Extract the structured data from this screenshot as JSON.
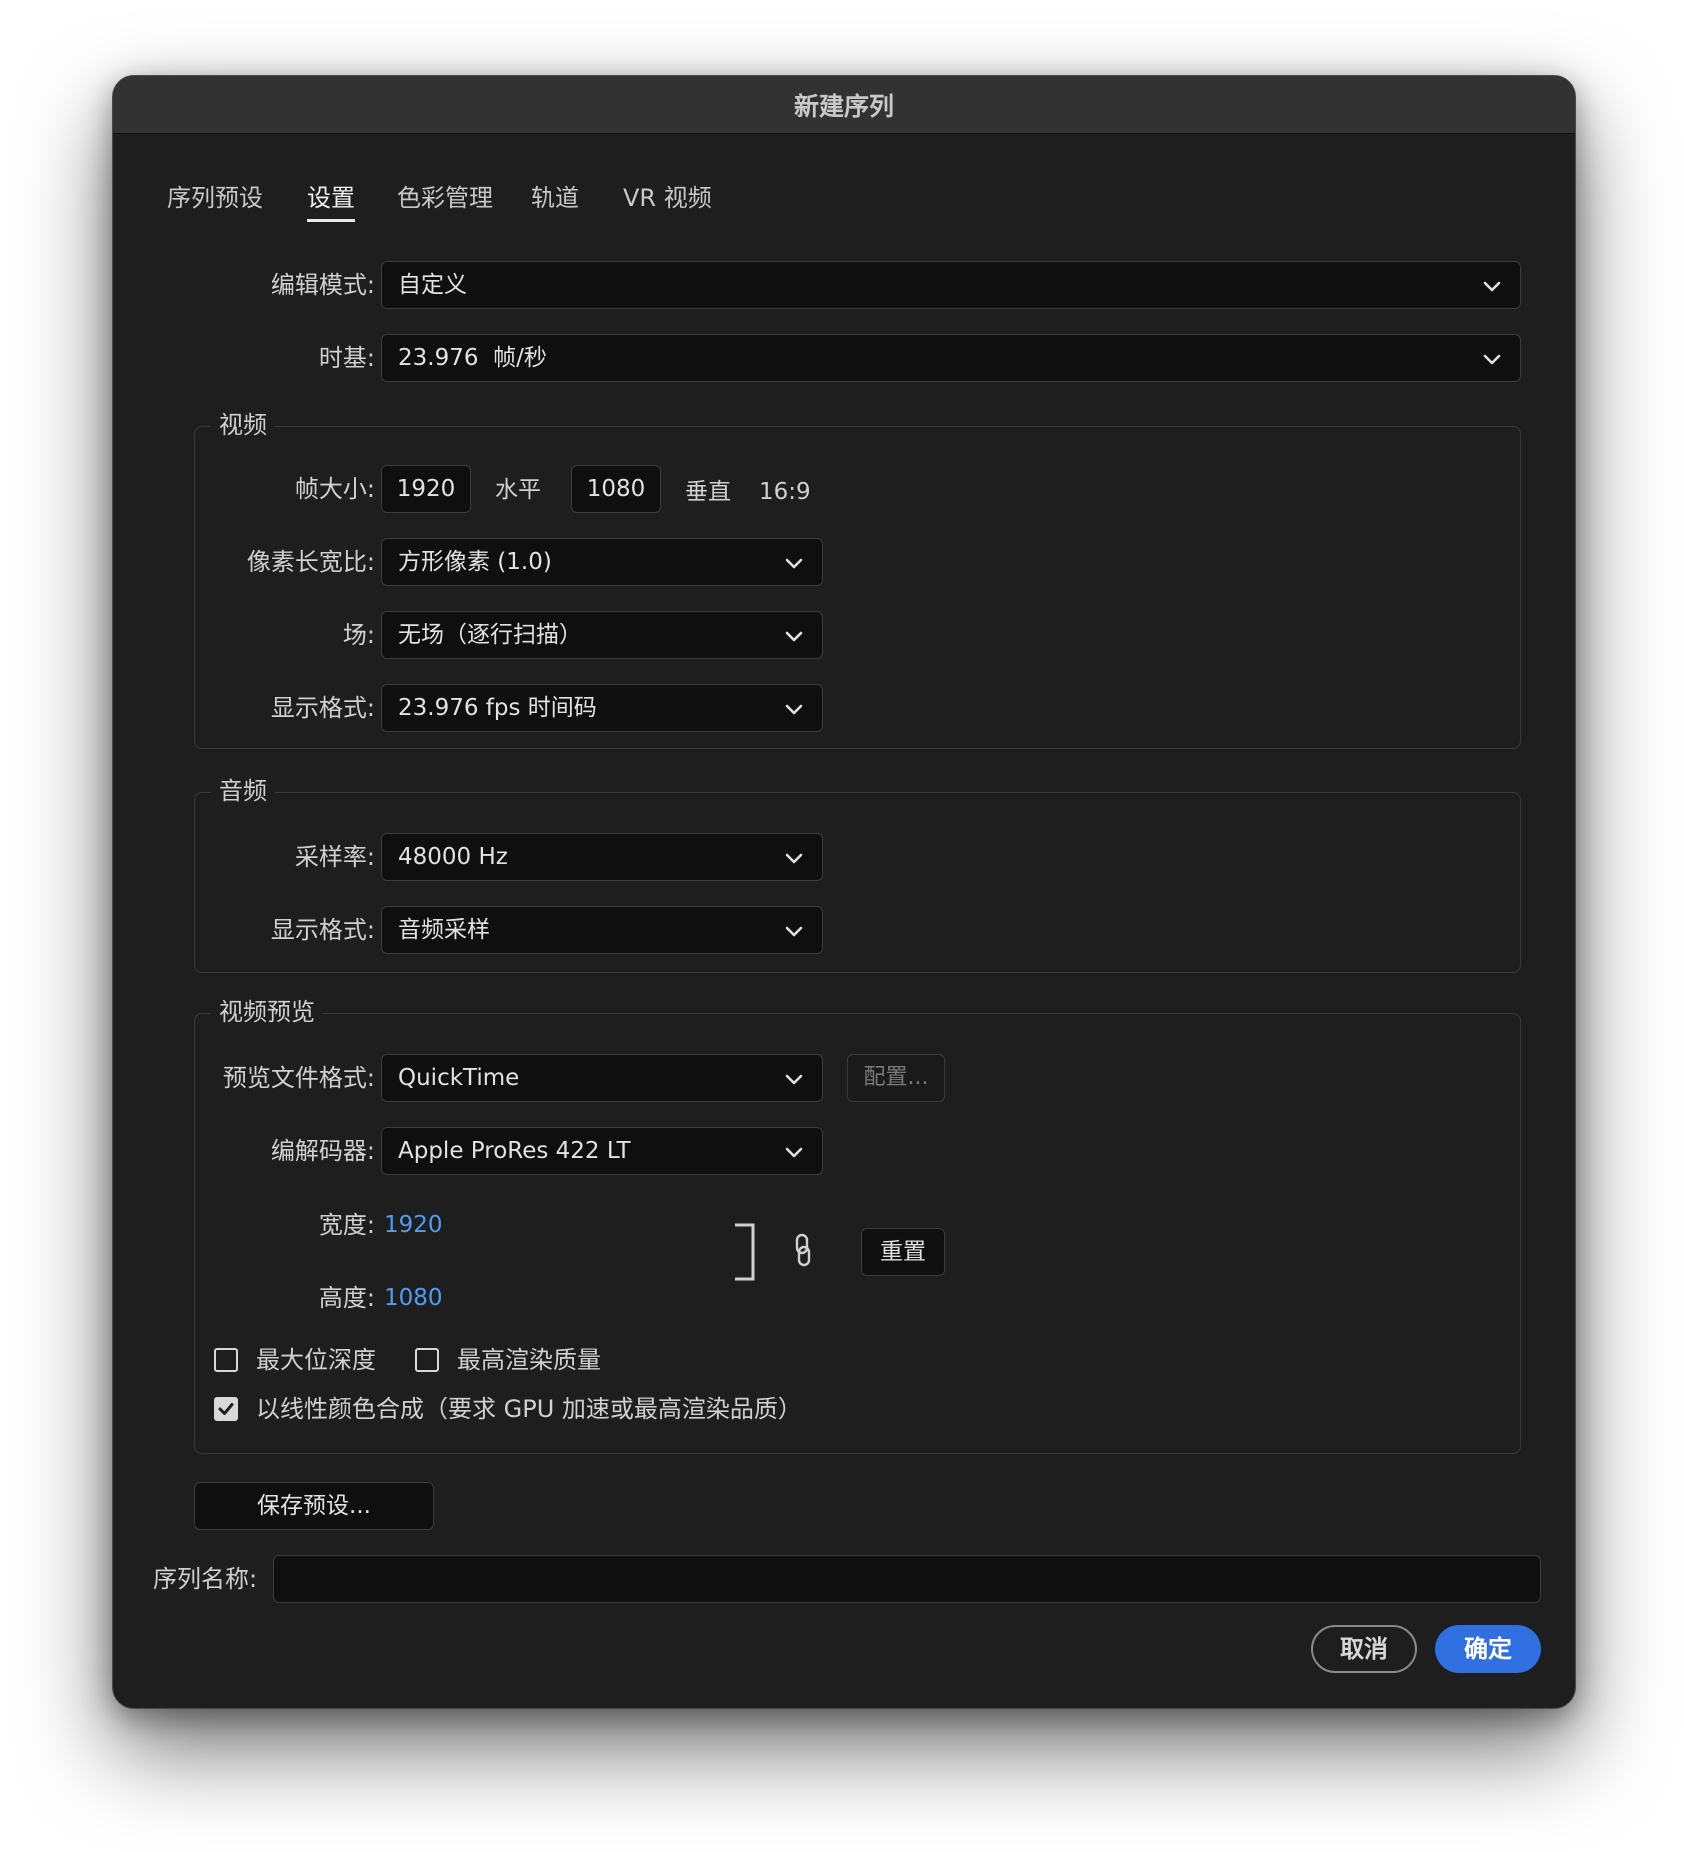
{
  "window": {
    "title": "新建序列"
  },
  "tabs": [
    {
      "label": "序列预设"
    },
    {
      "label": "设置"
    },
    {
      "label": "色彩管理"
    },
    {
      "label": "轨道"
    },
    {
      "label": "VR 视频"
    }
  ],
  "general": {
    "edit_mode_label": "编辑模式:",
    "edit_mode_value": "自定义",
    "timebase_label": "时基:",
    "timebase_value": "23.976  帧/秒"
  },
  "video": {
    "title": "视频",
    "frame_size_label": "帧大小:",
    "frame_width": "1920",
    "horizontal_label": "水平",
    "frame_height": "1080",
    "vertical_label": "垂直",
    "aspect": "16:9",
    "pixel_aspect_label": "像素长宽比:",
    "pixel_aspect_value": "方形像素 (1.0)",
    "fields_label": "场:",
    "fields_value": "无场（逐行扫描）",
    "display_format_label": "显示格式:",
    "display_format_value": "23.976 fps 时间码"
  },
  "audio": {
    "title": "音频",
    "sample_rate_label": "采样率:",
    "sample_rate_value": "48000 Hz",
    "display_format_label": "显示格式:",
    "display_format_value": "音频采样"
  },
  "preview": {
    "title": "视频预览",
    "file_format_label": "预览文件格式:",
    "file_format_value": "QuickTime",
    "configure_label": "配置...",
    "codec_label": "编解码器:",
    "codec_value": "Apple ProRes 422 LT",
    "width_label": "宽度:",
    "width_value": "1920",
    "height_label": "高度:",
    "height_value": "1080",
    "reset_label": "重置",
    "max_bit_depth_label": "最大位深度",
    "max_render_quality_label": "最高渲染质量",
    "linear_color_label": "以线性颜色合成（要求 GPU 加速或最高渲染品质）"
  },
  "footer": {
    "save_preset_label": "保存预设...",
    "sequence_name_label": "序列名称:",
    "sequence_name_value": "",
    "cancel_label": "取消",
    "ok_label": "确定"
  },
  "colors": {
    "background": "#1e1e1e",
    "accent": "#2f6fe0",
    "link": "#4f9cf0"
  },
  "icons": {
    "dropdown": "chevron-down-icon",
    "aspect_link": "link-icon",
    "checkbox_checked": "checkmark-icon"
  }
}
